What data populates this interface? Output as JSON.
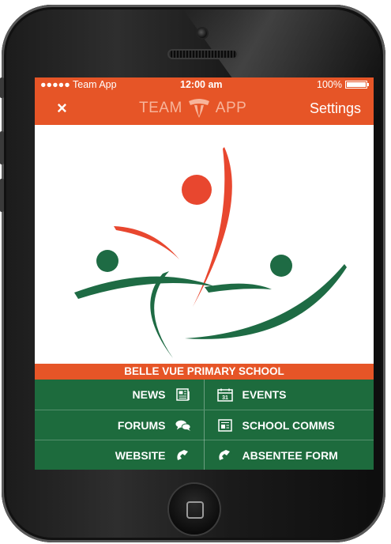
{
  "statusbar": {
    "carrier": "●●●●● Team App",
    "time": "12:00 am",
    "battery": "100%"
  },
  "navbar": {
    "close_label": "×",
    "brand_left": "TEAM",
    "brand_right": "APP",
    "settings_label": "Settings"
  },
  "school": {
    "name": "BELLE VUE PRIMARY SCHOOL"
  },
  "menu": {
    "rows": [
      {
        "left": {
          "label": "NEWS",
          "icon": "newspaper-icon"
        },
        "right": {
          "label": "EVENTS",
          "icon": "calendar-icon"
        }
      },
      {
        "left": {
          "label": "FORUMS",
          "icon": "chat-bubbles-icon"
        },
        "right": {
          "label": "SCHOOL COMMS",
          "icon": "document-icon"
        }
      },
      {
        "left": {
          "label": "WEBSITE",
          "icon": "link-check-icon"
        },
        "right": {
          "label": "ABSENTEE FORM",
          "icon": "link-check-icon"
        }
      }
    ]
  },
  "calendar_day": "31",
  "colors": {
    "accent": "#e65527",
    "menu_green": "#1d6b3d",
    "logo_red": "#e8472f",
    "logo_green": "#1e6b44"
  }
}
